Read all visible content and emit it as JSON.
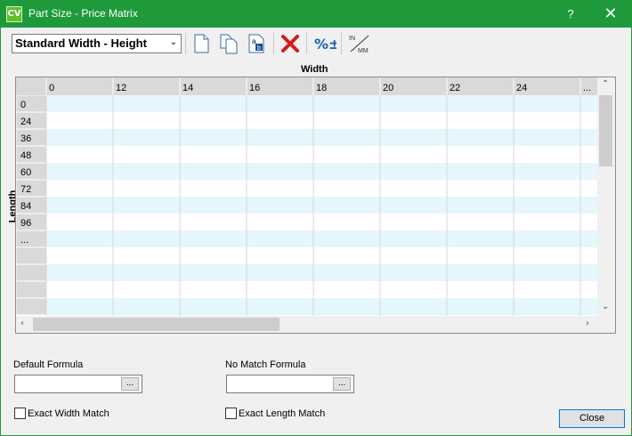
{
  "window": {
    "title": "Part Size - Price Matrix",
    "help": "?",
    "close": "✕",
    "app_badge": "CV"
  },
  "toolbar": {
    "matrix_type": "Standard Width - Height",
    "buttons": [
      "new-matrix",
      "copy-matrix",
      "rename-matrix",
      "delete-matrix",
      "percent-adjust",
      "inch-mm-toggle"
    ],
    "units_top": "IN",
    "units_bottom": "MM",
    "percent_glyph": "%±",
    "rename_glyph_a": "a",
    "rename_glyph_b": "b"
  },
  "grid": {
    "x_label": "Width",
    "y_label": "Length",
    "columns": [
      "0",
      "12",
      "14",
      "16",
      "18",
      "20",
      "22",
      "24",
      "..."
    ],
    "rows": [
      "0",
      "24",
      "36",
      "48",
      "60",
      "72",
      "84",
      "96",
      "...",
      "",
      "",
      "",
      ""
    ],
    "colors": {
      "alt_row": "#e6f6fd",
      "header": "#d9d9d9",
      "grid_line": "#d8d8d8"
    }
  },
  "formulas": {
    "default_label": "Default Formula",
    "default_value": "",
    "no_match_label": "No Match Formula",
    "no_match_value": "",
    "browse": "..."
  },
  "options": {
    "exact_width": "Exact Width Match",
    "exact_length": "Exact Length Match"
  },
  "footer": {
    "close": "Close"
  }
}
